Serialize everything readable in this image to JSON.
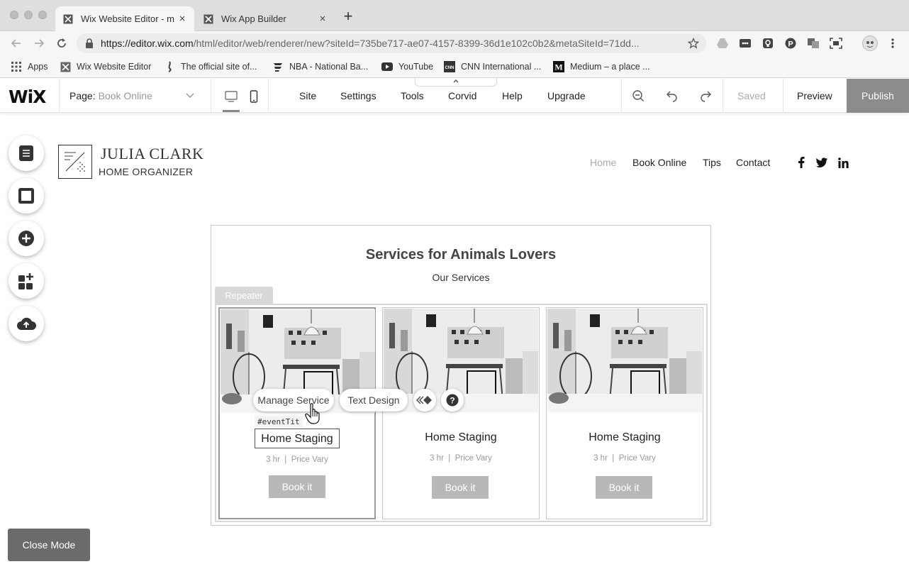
{
  "browser": {
    "tabs": [
      {
        "title": "Wix Website Editor - m",
        "active": true
      },
      {
        "title": "Wix App Builder",
        "active": false
      }
    ],
    "url_host": "https://editor.wix.com",
    "url_path": "/html/editor/web/renderer/new?siteId=735be717-ae07-4157-8399-36d1e102c0b2&metaSiteId=71dd...",
    "bookmarks": [
      {
        "label": "Apps",
        "icon": "apps-grid-icon"
      },
      {
        "label": "Wix Website Editor",
        "icon": "wix-favicon-icon"
      },
      {
        "label": "The official site of...",
        "icon": "nba-team-icon"
      },
      {
        "label": "NBA - National Ba...",
        "icon": "nba-icon"
      },
      {
        "label": "YouTube",
        "icon": "youtube-icon"
      },
      {
        "label": "CNN International ...",
        "icon": "cnn-icon"
      },
      {
        "label": "Medium – a place ...",
        "icon": "medium-icon"
      }
    ]
  },
  "editor": {
    "logo": "WiX",
    "page_label": "Page:",
    "page_value": "Book Online",
    "menu": [
      "Site",
      "Settings",
      "Tools",
      "Corvid",
      "Help",
      "Upgrade"
    ],
    "saved": "Saved",
    "preview": "Preview",
    "publish": "Publish",
    "close_mode": "Close Mode"
  },
  "site": {
    "name": "JULIA CLARK",
    "tagline": "HOME ORGANIZER",
    "nav": [
      "Home",
      "Book Online",
      "Tips",
      "Contact"
    ],
    "active_nav": "Home"
  },
  "services": {
    "title": "Services for Animals Lovers",
    "subtitle": "Our Services",
    "repeater_label": "Repeater",
    "cards": [
      {
        "title": "Home Staging",
        "duration": "3 hr",
        "price": "Price Vary",
        "button": "Book it"
      },
      {
        "title": "Home Staging",
        "duration": "3 hr",
        "price": "Price Vary",
        "button": "Book it"
      },
      {
        "title": "Home Staging",
        "duration": "3 hr",
        "price": "Price Vary",
        "button": "Book it"
      }
    ],
    "manage_service": "Manage Service",
    "text_design": "Text Design",
    "element_id": "#eventTit"
  },
  "colors": {
    "publish_bg": "#8c8c8c",
    "book_button": "#b8b8b8",
    "close_mode_bg": "#6b6b6b"
  }
}
